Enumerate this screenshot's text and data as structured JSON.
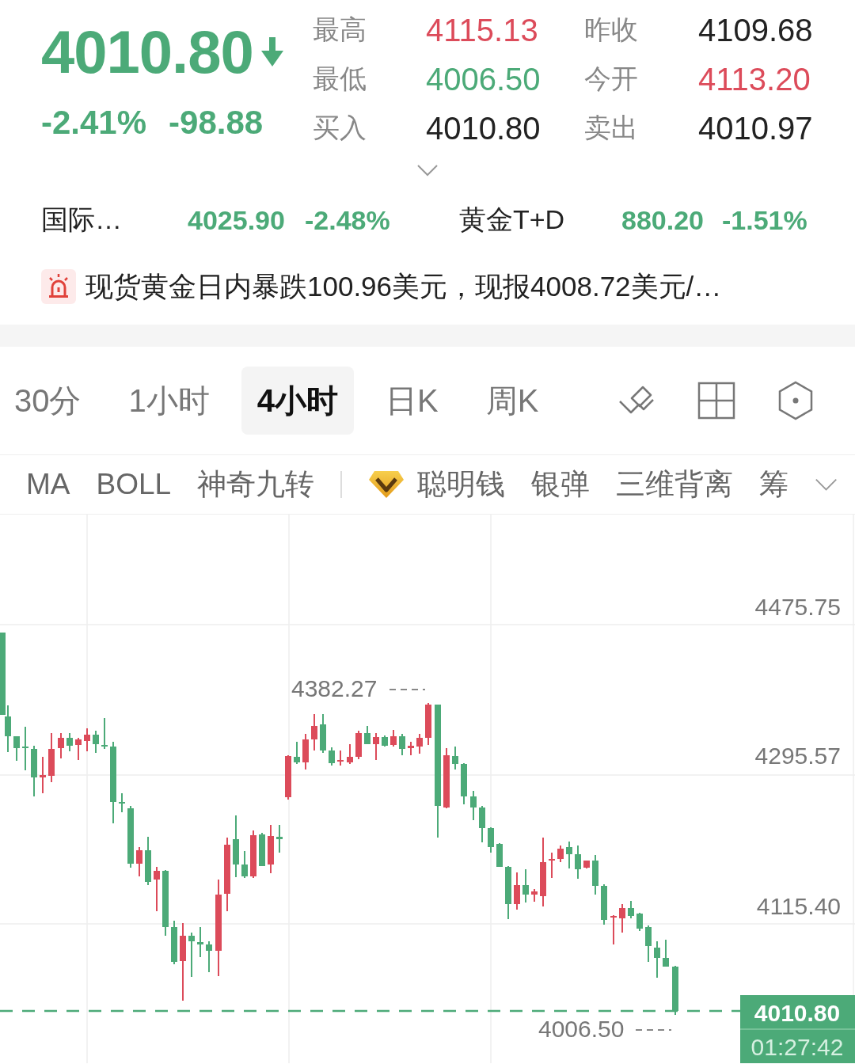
{
  "quote": {
    "price": "4010.80",
    "falling": true,
    "change_percent": "-2.41%",
    "change": "-98.88"
  },
  "stats": [
    {
      "label": "最高",
      "value": "4115.13",
      "color": "#dc4b5a"
    },
    {
      "label": "昨收",
      "value": "4109.68",
      "color": "#222222"
    },
    {
      "label": "最低",
      "value": "4006.50",
      "color": "#4caa78"
    },
    {
      "label": "今开",
      "value": "4113.20",
      "color": "#dc4b5a"
    },
    {
      "label": "买入",
      "value": "4010.80",
      "color": "#222222"
    },
    {
      "label": "卖出",
      "value": "4010.97",
      "color": "#222222"
    }
  ],
  "related": [
    {
      "name": "国际…",
      "price": "4025.90",
      "change": "-2.48%",
      "color": "#4caa78"
    },
    {
      "name": "黄金T+D",
      "price": "880.20",
      "change": "-1.51%",
      "color": "#4caa78"
    }
  ],
  "news": {
    "text": "现货黄金日内暴跌100.96美元，现报4008.72美元/…"
  },
  "periods": [
    {
      "label": "30分",
      "selected": false
    },
    {
      "label": "1小时",
      "selected": false
    },
    {
      "label": "4小时",
      "selected": true
    },
    {
      "label": "日K",
      "selected": false
    },
    {
      "label": "周K",
      "selected": false
    }
  ],
  "indicator_groups": [
    {
      "items": [
        {
          "label": "MA",
          "premium": false
        },
        {
          "label": "BOLL",
          "premium": false
        },
        {
          "label": "神奇九转",
          "premium": false
        }
      ]
    },
    {
      "items": [
        {
          "label": "聪明钱",
          "premium": true
        },
        {
          "label": "银弹",
          "premium": false
        },
        {
          "label": "三维背离",
          "premium": false
        },
        {
          "label": "筹",
          "premium": false
        }
      ]
    }
  ],
  "chart": {
    "y_labels": [
      "4475.75",
      "4295.57",
      "4115.40"
    ],
    "high_marker": "4382.27",
    "low_marker": "4006.50",
    "last_price": "4010.80",
    "countdown": "01:27:42"
  }
}
